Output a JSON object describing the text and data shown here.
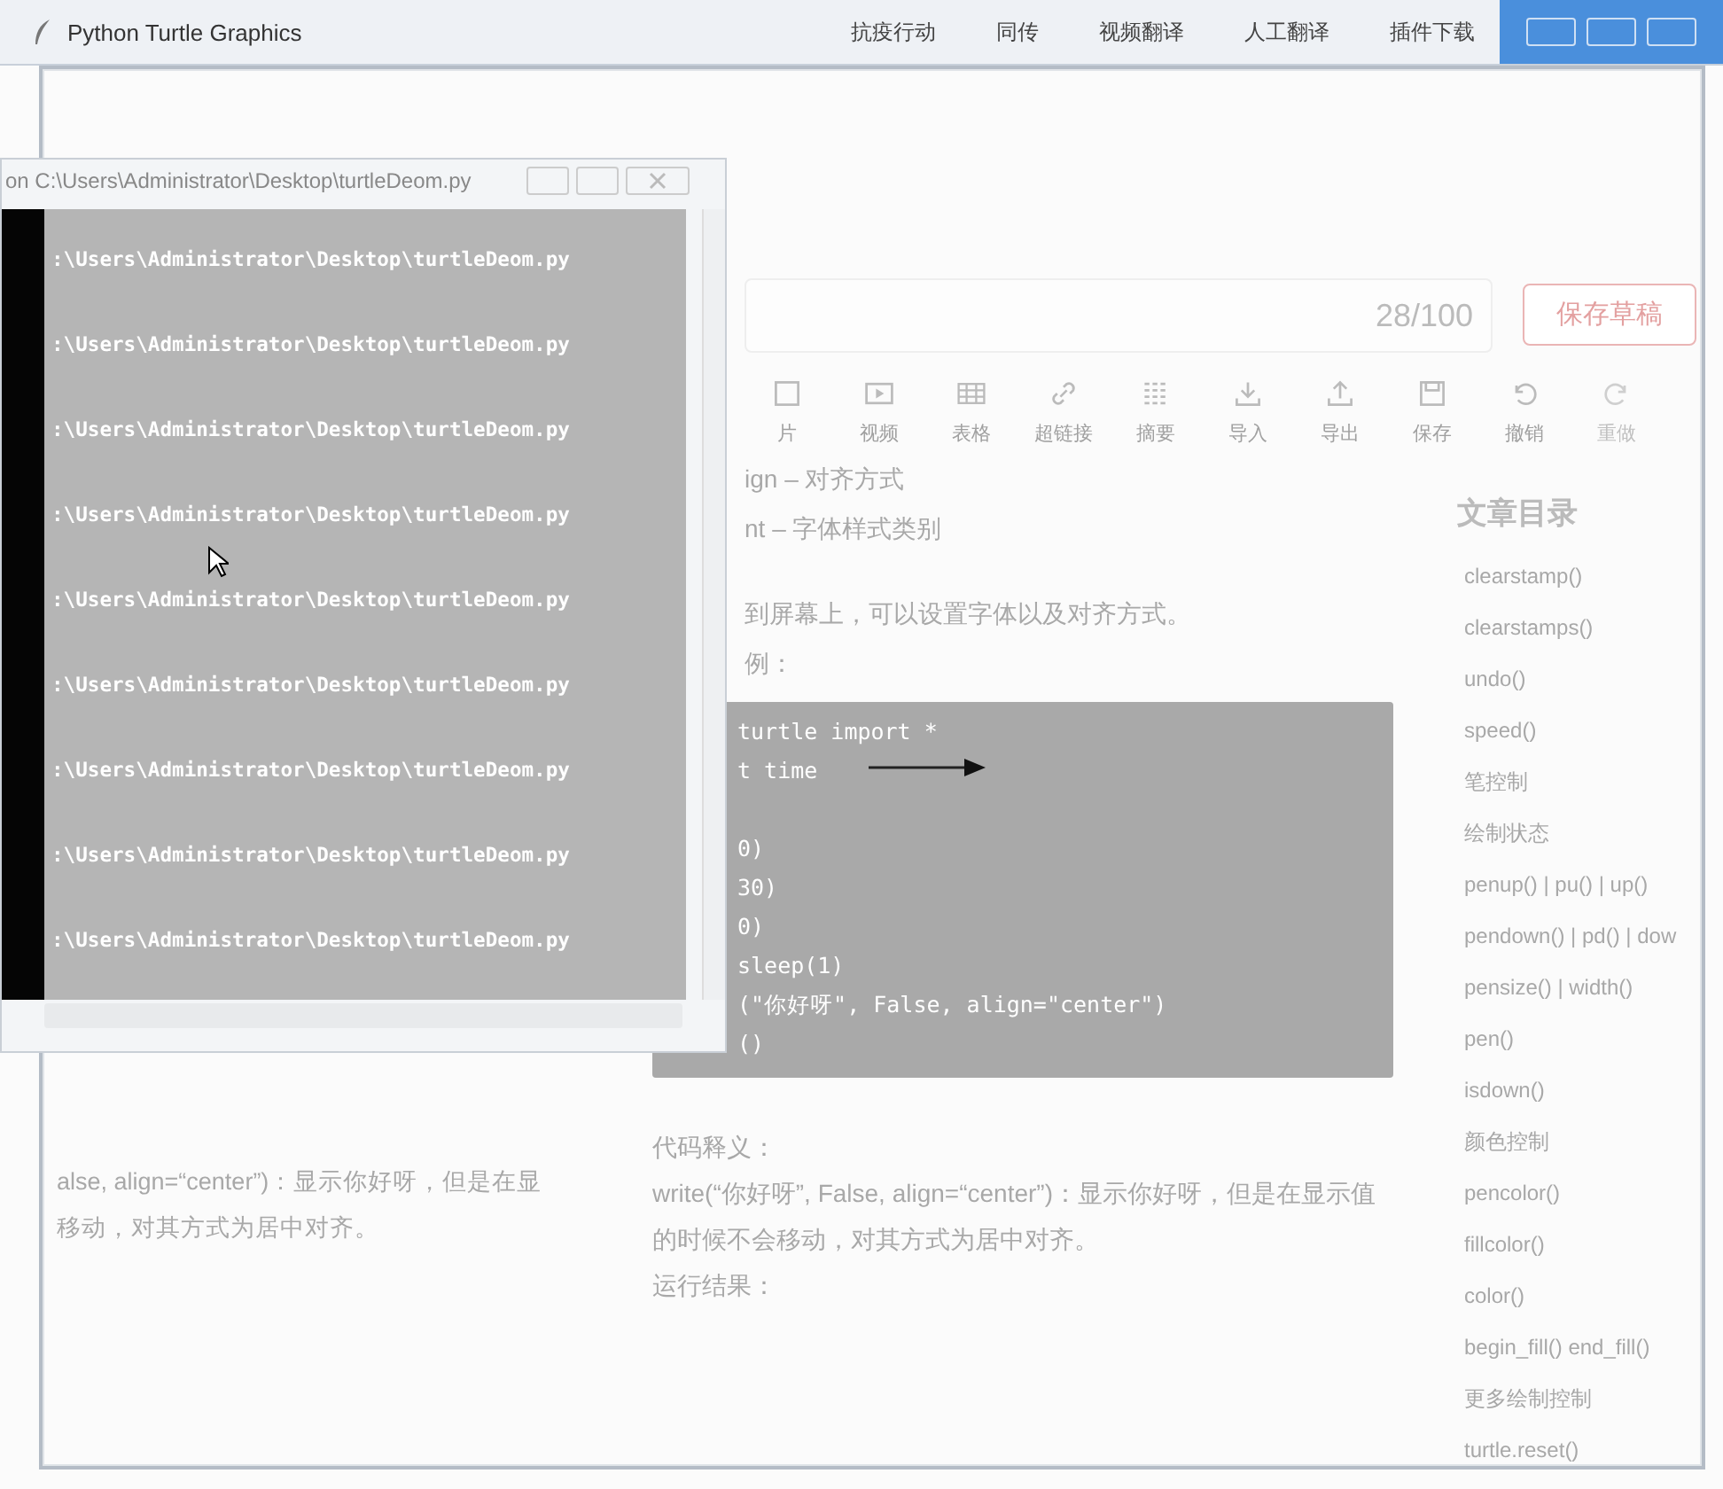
{
  "window": {
    "title": "Python Turtle Graphics"
  },
  "top_nav": [
    "抗疫行动",
    "同传",
    "视频翻译",
    "人工翻译",
    "插件下载"
  ],
  "console": {
    "title": "on  C:\\Users\\Administrator\\Desktop\\turtleDeom.py",
    "lines": [
      ":\\Users\\Administrator\\Desktop\\turtleDeom.py",
      ":\\Users\\Administrator\\Desktop\\turtleDeom.py",
      ":\\Users\\Administrator\\Desktop\\turtleDeom.py",
      ":\\Users\\Administrator\\Desktop\\turtleDeom.py",
      ":\\Users\\Administrator\\Desktop\\turtleDeom.py",
      ":\\Users\\Administrator\\Desktop\\turtleDeom.py",
      ":\\Users\\Administrator\\Desktop\\turtleDeom.py",
      ":\\Users\\Administrator\\Desktop\\turtleDeom.py",
      ":\\Users\\Administrator\\Desktop\\turtleDeom.py"
    ]
  },
  "editor": {
    "title_count": "28/100",
    "save_draft": "保存草稿",
    "toolbar": [
      {
        "kind": "image",
        "label": "片"
      },
      {
        "kind": "video",
        "label": "视频"
      },
      {
        "kind": "table",
        "label": "表格"
      },
      {
        "kind": "link",
        "label": "超链接"
      },
      {
        "kind": "summary",
        "label": "摘要"
      },
      {
        "kind": "import",
        "label": "导入"
      },
      {
        "kind": "export",
        "label": "导出"
      },
      {
        "kind": "save",
        "label": "保存"
      },
      {
        "kind": "undo",
        "label": "撤销"
      },
      {
        "kind": "redo",
        "label": "重做",
        "disabled": true
      }
    ]
  },
  "article": {
    "lines": [
      "ign – 对齐方式",
      "nt – 字体样式类别"
    ],
    "paragraphs": [
      "到屏幕上，可以设置字体以及对齐方式。",
      "例："
    ],
    "code_groups": [
      [
        "turtle import *",
        "t time"
      ],
      [
        "0)",
        "30)",
        "0)",
        "sleep(1)",
        "(\"你好呀\", False, align=\"center\")",
        "()"
      ]
    ],
    "after": [
      "代码释义：",
      "write(“你好呀”, False, align=“center”)：显示你好呀，但是在显示值的时候不会移动，对其方式为居中对齐。",
      "运行结果："
    ]
  },
  "left_text": [
    "alse, align=“center”)：显示你好呀，但是在显",
    "移动，对其方式为居中对齐。"
  ],
  "toc": {
    "title": "文章目录",
    "items": [
      "clearstamp()",
      "clearstamps()",
      "undo()",
      "speed()",
      "笔控制",
      "绘制状态",
      "penup() | pu() | up()",
      "pendown() | pd() | dow",
      "pensize() | width()",
      "pen()",
      "isdown()",
      "颜色控制",
      "pencolor()",
      "fillcolor()",
      "color()",
      "begin_fill() end_fill()",
      "更多绘制控制",
      "turtle.reset()"
    ]
  }
}
